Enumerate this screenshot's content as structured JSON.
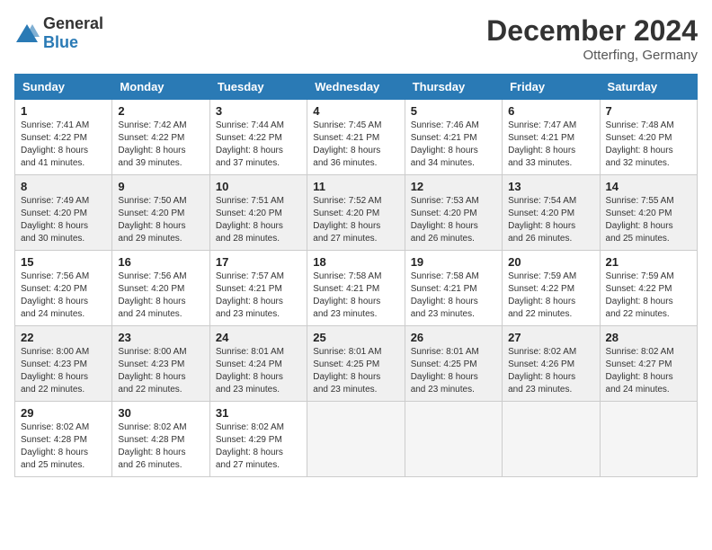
{
  "logo": {
    "text_general": "General",
    "text_blue": "Blue"
  },
  "header": {
    "month": "December 2024",
    "location": "Otterfing, Germany"
  },
  "days_of_week": [
    "Sunday",
    "Monday",
    "Tuesday",
    "Wednesday",
    "Thursday",
    "Friday",
    "Saturday"
  ],
  "weeks": [
    [
      {
        "day": "1",
        "sunrise": "7:41 AM",
        "sunset": "4:22 PM",
        "daylight": "8 hours and 41 minutes."
      },
      {
        "day": "2",
        "sunrise": "7:42 AM",
        "sunset": "4:22 PM",
        "daylight": "8 hours and 39 minutes."
      },
      {
        "day": "3",
        "sunrise": "7:44 AM",
        "sunset": "4:22 PM",
        "daylight": "8 hours and 37 minutes."
      },
      {
        "day": "4",
        "sunrise": "7:45 AM",
        "sunset": "4:21 PM",
        "daylight": "8 hours and 36 minutes."
      },
      {
        "day": "5",
        "sunrise": "7:46 AM",
        "sunset": "4:21 PM",
        "daylight": "8 hours and 34 minutes."
      },
      {
        "day": "6",
        "sunrise": "7:47 AM",
        "sunset": "4:21 PM",
        "daylight": "8 hours and 33 minutes."
      },
      {
        "day": "7",
        "sunrise": "7:48 AM",
        "sunset": "4:20 PM",
        "daylight": "8 hours and 32 minutes."
      }
    ],
    [
      {
        "day": "8",
        "sunrise": "7:49 AM",
        "sunset": "4:20 PM",
        "daylight": "8 hours and 30 minutes."
      },
      {
        "day": "9",
        "sunrise": "7:50 AM",
        "sunset": "4:20 PM",
        "daylight": "8 hours and 29 minutes."
      },
      {
        "day": "10",
        "sunrise": "7:51 AM",
        "sunset": "4:20 PM",
        "daylight": "8 hours and 28 minutes."
      },
      {
        "day": "11",
        "sunrise": "7:52 AM",
        "sunset": "4:20 PM",
        "daylight": "8 hours and 27 minutes."
      },
      {
        "day": "12",
        "sunrise": "7:53 AM",
        "sunset": "4:20 PM",
        "daylight": "8 hours and 26 minutes."
      },
      {
        "day": "13",
        "sunrise": "7:54 AM",
        "sunset": "4:20 PM",
        "daylight": "8 hours and 26 minutes."
      },
      {
        "day": "14",
        "sunrise": "7:55 AM",
        "sunset": "4:20 PM",
        "daylight": "8 hours and 25 minutes."
      }
    ],
    [
      {
        "day": "15",
        "sunrise": "7:56 AM",
        "sunset": "4:20 PM",
        "daylight": "8 hours and 24 minutes."
      },
      {
        "day": "16",
        "sunrise": "7:56 AM",
        "sunset": "4:20 PM",
        "daylight": "8 hours and 24 minutes."
      },
      {
        "day": "17",
        "sunrise": "7:57 AM",
        "sunset": "4:21 PM",
        "daylight": "8 hours and 23 minutes."
      },
      {
        "day": "18",
        "sunrise": "7:58 AM",
        "sunset": "4:21 PM",
        "daylight": "8 hours and 23 minutes."
      },
      {
        "day": "19",
        "sunrise": "7:58 AM",
        "sunset": "4:21 PM",
        "daylight": "8 hours and 23 minutes."
      },
      {
        "day": "20",
        "sunrise": "7:59 AM",
        "sunset": "4:22 PM",
        "daylight": "8 hours and 22 minutes."
      },
      {
        "day": "21",
        "sunrise": "7:59 AM",
        "sunset": "4:22 PM",
        "daylight": "8 hours and 22 minutes."
      }
    ],
    [
      {
        "day": "22",
        "sunrise": "8:00 AM",
        "sunset": "4:23 PM",
        "daylight": "8 hours and 22 minutes."
      },
      {
        "day": "23",
        "sunrise": "8:00 AM",
        "sunset": "4:23 PM",
        "daylight": "8 hours and 22 minutes."
      },
      {
        "day": "24",
        "sunrise": "8:01 AM",
        "sunset": "4:24 PM",
        "daylight": "8 hours and 23 minutes."
      },
      {
        "day": "25",
        "sunrise": "8:01 AM",
        "sunset": "4:25 PM",
        "daylight": "8 hours and 23 minutes."
      },
      {
        "day": "26",
        "sunrise": "8:01 AM",
        "sunset": "4:25 PM",
        "daylight": "8 hours and 23 minutes."
      },
      {
        "day": "27",
        "sunrise": "8:02 AM",
        "sunset": "4:26 PM",
        "daylight": "8 hours and 23 minutes."
      },
      {
        "day": "28",
        "sunrise": "8:02 AM",
        "sunset": "4:27 PM",
        "daylight": "8 hours and 24 minutes."
      }
    ],
    [
      {
        "day": "29",
        "sunrise": "8:02 AM",
        "sunset": "4:28 PM",
        "daylight": "8 hours and 25 minutes."
      },
      {
        "day": "30",
        "sunrise": "8:02 AM",
        "sunset": "4:28 PM",
        "daylight": "8 hours and 26 minutes."
      },
      {
        "day": "31",
        "sunrise": "8:02 AM",
        "sunset": "4:29 PM",
        "daylight": "8 hours and 27 minutes."
      },
      null,
      null,
      null,
      null
    ]
  ]
}
